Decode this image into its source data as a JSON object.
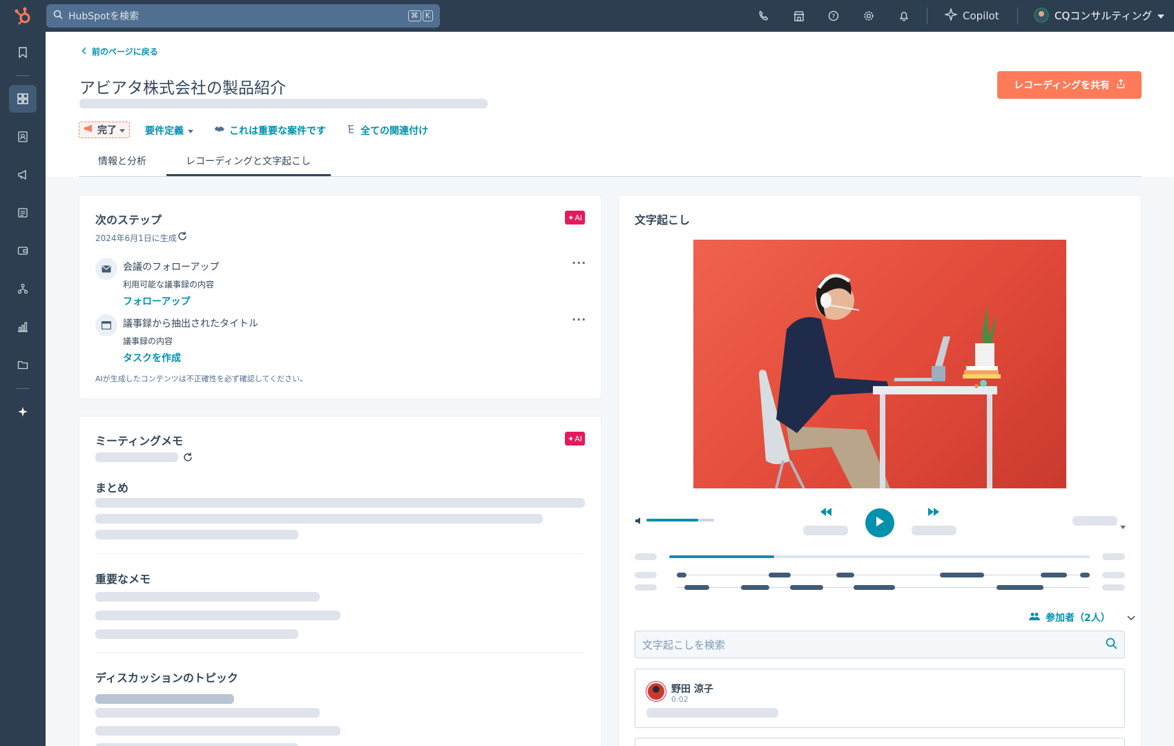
{
  "topbar": {
    "search_placeholder": "HubSpotを検索",
    "shortcut_keys": [
      "⌘",
      "K"
    ],
    "copilot_label": "Copilot",
    "account_name": "CQコンサルティング"
  },
  "page": {
    "back_label": "前のページに戻る",
    "title": "アビアタ株式会社の製品紹介",
    "share_button": "レコーディングを共有",
    "status_label": "完了",
    "stage_label": "要件定義",
    "important_label": "これは重要な案件です",
    "associations_label": "全ての関連付け",
    "tabs": [
      {
        "label": "情報と分析",
        "active": false
      },
      {
        "label": "レコーディングと文字起こし",
        "active": true
      }
    ]
  },
  "next_steps": {
    "title": "次のステップ",
    "ai_badge": "AI",
    "generated_date": "2024年6月1日に生成",
    "steps": [
      {
        "title": "会議のフォローアップ",
        "subtitle": "利用可能な議事録の内容",
        "action": "フォローアップ",
        "icon": "email-icon"
      },
      {
        "title": "議事録から抽出されたタイトル",
        "subtitle": "議事録の内容",
        "action": "タスクを作成",
        "icon": "task-icon"
      }
    ],
    "disclaimer": "AIが生成したコンテンツは不正確性を必ず確認してください。"
  },
  "meeting_notes": {
    "title": "ミーティングメモ",
    "ai_badge": "AI",
    "sections": [
      "まとめ",
      "重要なメモ",
      "ディスカッションのトピック"
    ]
  },
  "transcript": {
    "title": "文字起こし",
    "volume_level": 0.77,
    "playback_progress": 0.25,
    "participants_label": "参加者（2人）",
    "search_placeholder": "文字起こしを検索",
    "entries": [
      {
        "speaker": "野田 涼子",
        "time": "0:02"
      }
    ]
  },
  "colors": {
    "nav": "#2d3e50",
    "accent": "#0091ae",
    "cta": "#ff7a59",
    "ai": "#e5195b"
  }
}
